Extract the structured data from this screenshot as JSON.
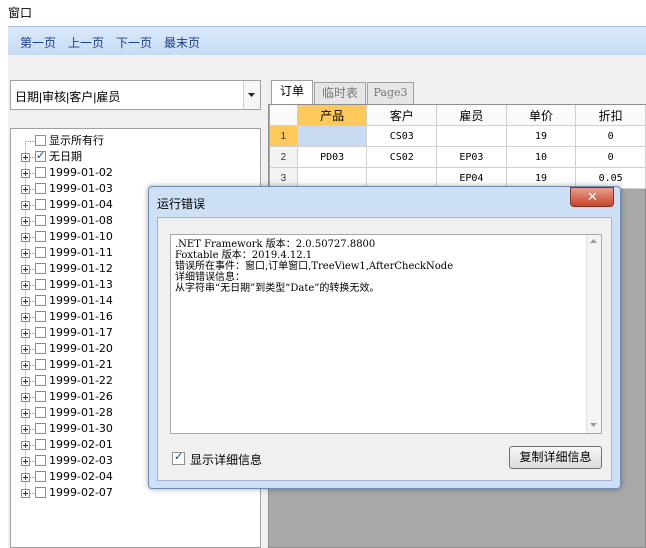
{
  "window": {
    "title": "窗口"
  },
  "nav": {
    "items": [
      "第一页",
      "上一页",
      "下一页",
      "最末页"
    ]
  },
  "combo": {
    "value": "日期|审核|客户|雇员"
  },
  "tree": {
    "root_label": "显示所有行",
    "items": [
      {
        "label": "无日期",
        "checked": true
      },
      {
        "label": "1999-01-02",
        "checked": false
      },
      {
        "label": "1999-01-03",
        "checked": false
      },
      {
        "label": "1999-01-04",
        "checked": false
      },
      {
        "label": "1999-01-08",
        "checked": false
      },
      {
        "label": "1999-01-10",
        "checked": false
      },
      {
        "label": "1999-01-11",
        "checked": false
      },
      {
        "label": "1999-01-12",
        "checked": false
      },
      {
        "label": "1999-01-13",
        "checked": false
      },
      {
        "label": "1999-01-14",
        "checked": false
      },
      {
        "label": "1999-01-16",
        "checked": false
      },
      {
        "label": "1999-01-17",
        "checked": false
      },
      {
        "label": "1999-01-20",
        "checked": false
      },
      {
        "label": "1999-01-21",
        "checked": false
      },
      {
        "label": "1999-01-22",
        "checked": false
      },
      {
        "label": "1999-01-26",
        "checked": false
      },
      {
        "label": "1999-01-28",
        "checked": false
      },
      {
        "label": "1999-01-30",
        "checked": false
      },
      {
        "label": "1999-02-01",
        "checked": false
      },
      {
        "label": "1999-02-03",
        "checked": false
      },
      {
        "label": "1999-02-04",
        "checked": false
      },
      {
        "label": "1999-02-07",
        "checked": false
      }
    ]
  },
  "tabs": [
    {
      "label": "订单",
      "active": true
    },
    {
      "label": "临时表",
      "active": false
    },
    {
      "label": "Page3",
      "active": false
    }
  ],
  "grid": {
    "columns": [
      "产品",
      "客户",
      "雇员",
      "单价",
      "折扣"
    ],
    "rows": [
      {
        "num": "1",
        "cells": [
          "",
          "CS03",
          "",
          "19",
          "0"
        ]
      },
      {
        "num": "2",
        "cells": [
          "PD03",
          "CS02",
          "EP03",
          "10",
          "0"
        ]
      },
      {
        "num": "3",
        "cells": [
          "",
          "",
          "EP04",
          "19",
          "0.05"
        ]
      }
    ]
  },
  "dialog": {
    "title": "运行错误",
    "close_glyph": "✕",
    "message_lines": [
      ".NET Framework 版本：2.0.50727.8800",
      "Foxtable 版本：2019.4.12.1",
      "错误所在事件：窗口,订单窗口,TreeView1,AfterCheckNode",
      "详细错误信息：",
      "从字符串“无日期”到类型“Date”的转换无效。"
    ],
    "show_details_label": "显示详细信息",
    "show_details_checked": true,
    "copy_button_label": "复制详细信息"
  }
}
